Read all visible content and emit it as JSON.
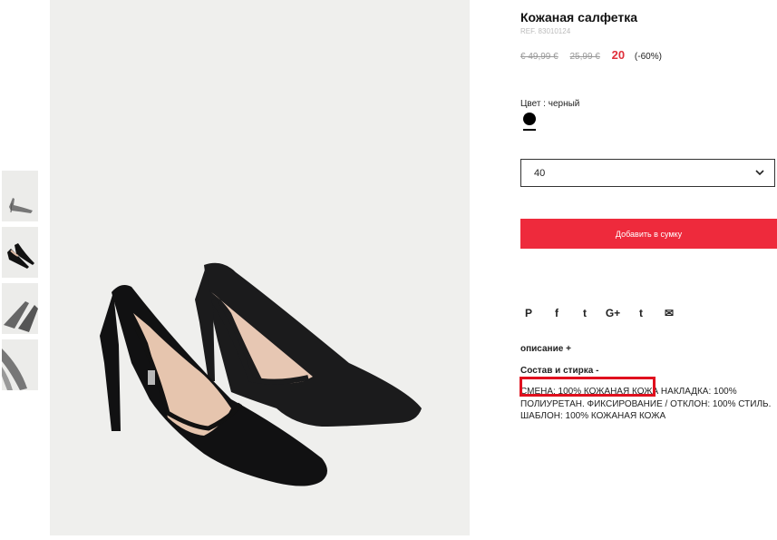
{
  "product": {
    "title": "Кожаная салфетка",
    "ref": "REF. 83010124",
    "price_old_1": "€ 49,99 €",
    "price_old_2": "25,99 €",
    "price_new": "20",
    "discount": "(-60%)"
  },
  "color": {
    "label": "Цвет : черный",
    "selected_swatch": "#000000"
  },
  "size": {
    "selected": "40"
  },
  "cart": {
    "add_label": "Добавить в сумку",
    "accent_color": "#ee2a3c"
  },
  "share": {
    "icons": [
      "pinterest-icon",
      "facebook-icon",
      "twitter-icon",
      "google-plus-icon",
      "tumblr-icon",
      "email-icon"
    ],
    "glyphs": [
      "P",
      "f",
      "t",
      "G+",
      "t",
      "✉"
    ]
  },
  "sections": {
    "description": "описание +",
    "composition": "Состав и стирка -",
    "composition_text": "СМЕНА: 100% КОЖАНАЯ КОЖА НАКЛАДКА: 100% ПОЛИУРЕТАН. ФИКСИРОВАНИЕ / ОТКЛОН: 100% СТИЛЬ. ШАБЛОН: 100% КОЖАНАЯ КОЖА"
  }
}
